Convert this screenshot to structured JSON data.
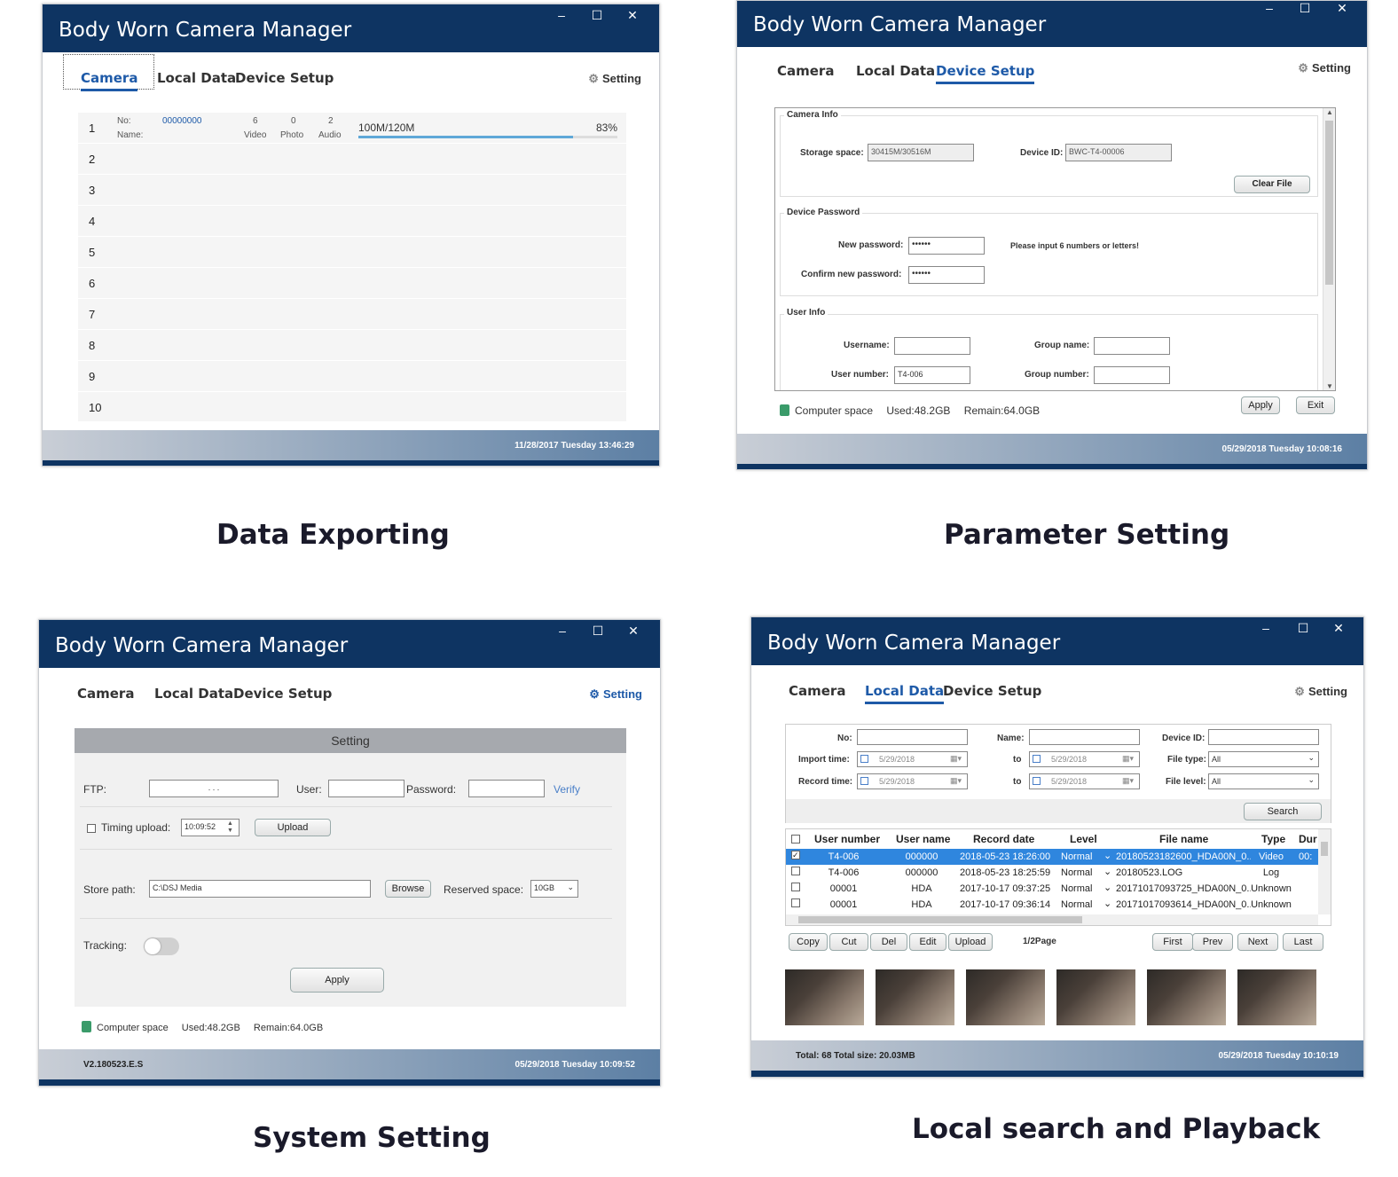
{
  "app_title": "Body Worn Camera Manager",
  "window_controls": {
    "minimize": "–",
    "maximize": "☐",
    "close": "✕"
  },
  "tabs": {
    "camera": "Camera",
    "local_data": "Local Data",
    "device_setup": "Device Setup",
    "setting": "Setting"
  },
  "win1": {
    "caption": "Data Exporting",
    "row1": {
      "number": "1",
      "no_label": "No:",
      "no_value": "00000000",
      "name_label": "Name:",
      "video_count": "6",
      "video_label": "Video",
      "photo_count": "0",
      "photo_label": "Photo",
      "audio_count": "2",
      "audio_label": "Audio",
      "storage": "100M/120M",
      "percent_text": "83%",
      "progress": 0.83
    },
    "rows": [
      "2",
      "3",
      "4",
      "5",
      "6",
      "7",
      "8",
      "9",
      "10"
    ],
    "timestamp": "11/28/2017 Tuesday 13:46:29"
  },
  "win2": {
    "caption": "Parameter Setting",
    "camera_info_title": "Camera Info",
    "storage_label": "Storage space:",
    "storage_value": "30415M/30516M",
    "device_id_label": "Device ID:",
    "device_id_value": "BWC-T4-00006",
    "clear_file": "Clear File",
    "device_password_title": "Device Password",
    "new_password_label": "New password:",
    "new_password_value": "••••••",
    "confirm_password_label": "Confirm new password:",
    "confirm_password_value": "••••••",
    "password_hint": "Please input 6 numbers or letters!",
    "user_info_title": "User Info",
    "username_label": "Username:",
    "group_name_label": "Group name:",
    "user_number_label": "User number:",
    "user_number_value": "T4-006",
    "group_number_label": "Group number:",
    "computer_space": "Computer space",
    "used": "Used:48.2GB",
    "remain": "Remain:64.0GB",
    "apply": "Apply",
    "exit": "Exit",
    "timestamp": "05/29/2018 Tuesday 10:08:16"
  },
  "win3": {
    "caption": "System Setting",
    "panel_title": "Setting",
    "ftp_label": "FTP:",
    "ftp_value": ".      .      .",
    "user_label": "User:",
    "password_label": "Password:",
    "verify": "Verify",
    "timing_upload_label": "Timing upload:",
    "timing_value": "10:09:52",
    "upload": "Upload",
    "store_path_label": "Store path:",
    "store_path_value": "C:\\DSJ Media",
    "browse": "Browse",
    "reserved_space_label": "Reserved space:",
    "reserved_space_value": "10GB",
    "tracking_label": "Tracking:",
    "apply": "Apply",
    "computer_space": "Computer space",
    "used": "Used:48.2GB",
    "remain": "Remain:64.0GB",
    "version": "V2.180523.E.S",
    "timestamp": "05/29/2018 Tuesday 10:09:52"
  },
  "win4": {
    "caption": "Local search and Playback",
    "no_label": "No:",
    "name_label": "Name:",
    "device_id_label": "Device ID:",
    "import_time_label": "Import time:",
    "record_time_label": "Record time:",
    "to_label": "to",
    "date_value": "5/29/2018",
    "file_type_label": "File type:",
    "file_level_label": "File level:",
    "all": "All",
    "search": "Search",
    "columns": [
      "User number",
      "User name",
      "Record date",
      "Level",
      "File name",
      "Type",
      "Dur"
    ],
    "rows": [
      [
        "T4-006",
        "000000",
        "2018-05-23 18:26:00",
        "Normal",
        "20180523182600_HDA00N_0...",
        "Video",
        "00:"
      ],
      [
        "T4-006",
        "000000",
        "2018-05-23 18:25:59",
        "Normal",
        "20180523.LOG",
        "Log",
        ""
      ],
      [
        "00001",
        "HDA",
        "2017-10-17 09:37:25",
        "Normal",
        "20171017093725_HDA00N_0...",
        "Unknown",
        ""
      ],
      [
        "00001",
        "HDA",
        "2017-10-17 09:36:14",
        "Normal",
        "20171017093614_HDA00N_0...",
        "Unknown",
        ""
      ]
    ],
    "buttons": [
      "Copy",
      "Cut",
      "Del",
      "Edit",
      "Upload"
    ],
    "page": "1/2Page",
    "nav_buttons": [
      "First",
      "Prev",
      "Next",
      "Last"
    ],
    "total": "Total: 68 Total size: 20.03MB",
    "timestamp": "05/29/2018 Tuesday 10:10:19",
    "colors": {
      "selected_row": "#2f86de"
    }
  }
}
